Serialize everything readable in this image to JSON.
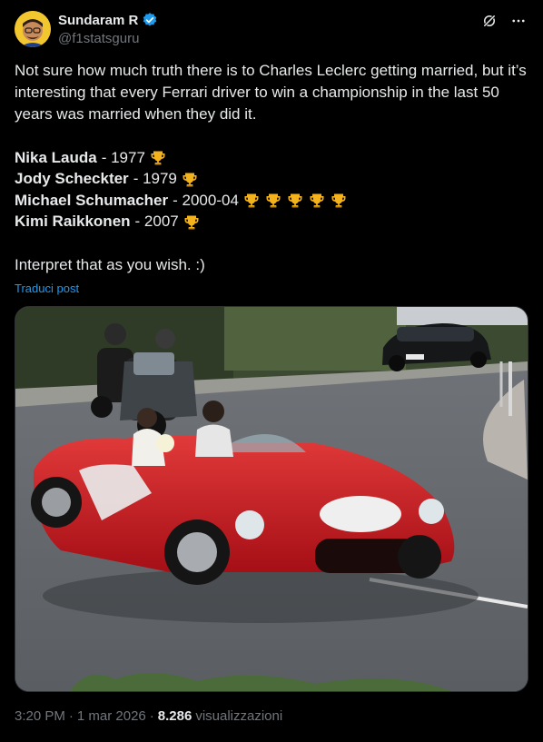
{
  "author": {
    "name": "Sundaram R",
    "handle": "@f1statsguru",
    "verified_color": "#1d9bf0"
  },
  "top_actions": {
    "grok_icon": "grok-icon",
    "more_icon": "more-icon"
  },
  "tweet": {
    "intro": "Not sure how much truth there is to Charles Leclerc getting married, but it’s interesting that every Ferrari driver to win a championship in the last 50 years was married when they did it.",
    "champions": [
      {
        "name": "Nika Lauda",
        "sep": "- 1977",
        "trophies": 1
      },
      {
        "name": "Jody Scheckter",
        "sep": "- 1979",
        "trophies": 1
      },
      {
        "name": "Michael Schumacher",
        "sep": "- 2000-04",
        "trophies": 5
      },
      {
        "name": "Kimi Raikkonen",
        "sep": "- 2007",
        "trophies": 1
      }
    ],
    "outro": "Interpret that as you wish. :)",
    "translate_label": "Traduci post"
  },
  "footer": {
    "time": "3:20 PM",
    "dot1": "·",
    "date": "1 mar 2026",
    "dot2": "·",
    "views_count": "8.286",
    "views_label": "visualizzazioni"
  },
  "colors": {
    "background": "#000000",
    "text": "#e7e9ea",
    "muted": "#71767b",
    "link": "#1d9bf0",
    "car_red": "#c8141c"
  }
}
